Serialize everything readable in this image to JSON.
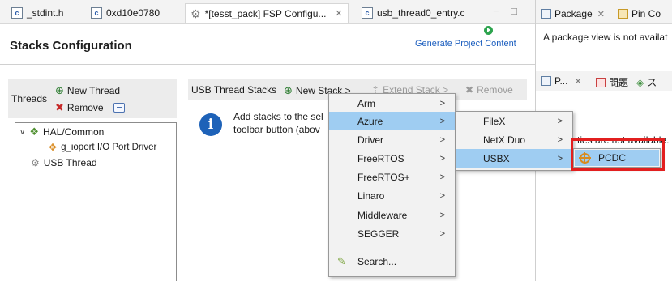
{
  "editor_tabs": [
    {
      "label": "_stdint.h",
      "icon": "c-file-icon"
    },
    {
      "label": "0xd10e0780",
      "icon": "c-file-icon"
    },
    {
      "label": "*[tesst_pack] FSP Configu...",
      "icon": "gear-icon",
      "active": true
    },
    {
      "label": "usb_thread0_entry.c",
      "icon": "c-file-icon"
    }
  ],
  "window_controls": {
    "minimize": "−",
    "maximize": "□"
  },
  "stacks_config": {
    "title": "Stacks Configuration",
    "generate_label": "Generate Project Content"
  },
  "threads": {
    "label": "Threads",
    "new_thread": "New Thread",
    "remove": "Remove",
    "tree": [
      {
        "label": "HAL/Common",
        "expanded": true
      },
      {
        "label": "g_ioport I/O Port Driver"
      },
      {
        "label": "USB Thread",
        "selected": true
      }
    ]
  },
  "stacks": {
    "header": "USB Thread Stacks",
    "new_stack": "New Stack >",
    "extend_stack": "Extend Stack >",
    "remove": "Remove",
    "info_line1": "Add stacks to the sel",
    "info_line2": "toolbar button (abov"
  },
  "context_menu": {
    "items": [
      "Arm",
      "Azure",
      "Driver",
      "FreeRTOS",
      "FreeRTOS+",
      "Linaro",
      "Middleware",
      "SEGGER",
      "Search..."
    ],
    "highlighted": "Azure",
    "azure_submenu": [
      "FileX",
      "NetX Duo",
      "USBX"
    ],
    "azure_highlighted": "USBX",
    "usbx_submenu": [
      "PCDC"
    ]
  },
  "right_panel": {
    "tabs": [
      "Package",
      "Pin Co"
    ],
    "package_message": "A package view is not availat",
    "bottom_tabs": [
      "P...",
      "問題",
      "ス"
    ],
    "properties_fragment": "ties are not available."
  },
  "colors": {
    "accent": "#1d5fbf",
    "menu_highlight": "#9fcdf2",
    "callout_red": "#e21f1f"
  }
}
